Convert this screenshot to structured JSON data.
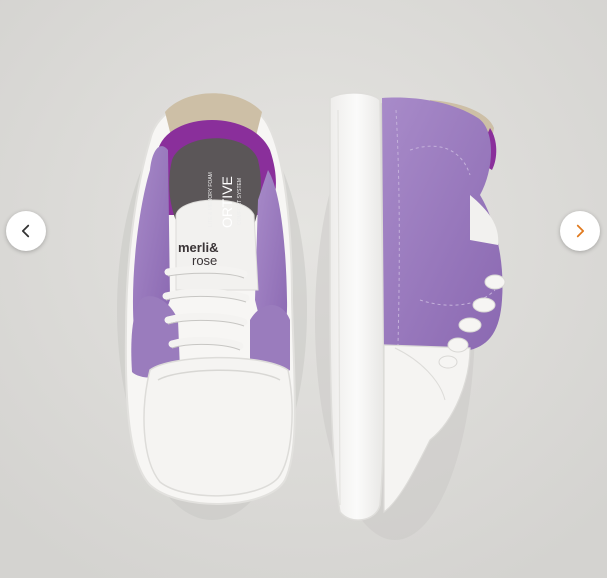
{
  "carousel": {
    "prev_label": "Previous image",
    "next_label": "Next image",
    "prev_icon": "chevron-left-icon",
    "next_icon": "chevron-right-icon",
    "prev_arrow_color": "#333333",
    "next_arrow_color": "#e07a1f"
  },
  "product_image": {
    "insole_brand_line1": "merli&",
    "insole_brand_line2": "rose",
    "insole_tech_line1": "ORTIVE",
    "insole_tech_line2": "LITE & MEMORY FOAM",
    "insole_tech_line3": "COMFORT SYSTEM",
    "colors": {
      "suede": "#9b7bbd",
      "suede_dark": "#7e5ea6",
      "collar": "#8a2f9b",
      "leather": "#f4f3f1",
      "heel_tab": "#cdbfa6",
      "background": "#dddcd9"
    }
  }
}
